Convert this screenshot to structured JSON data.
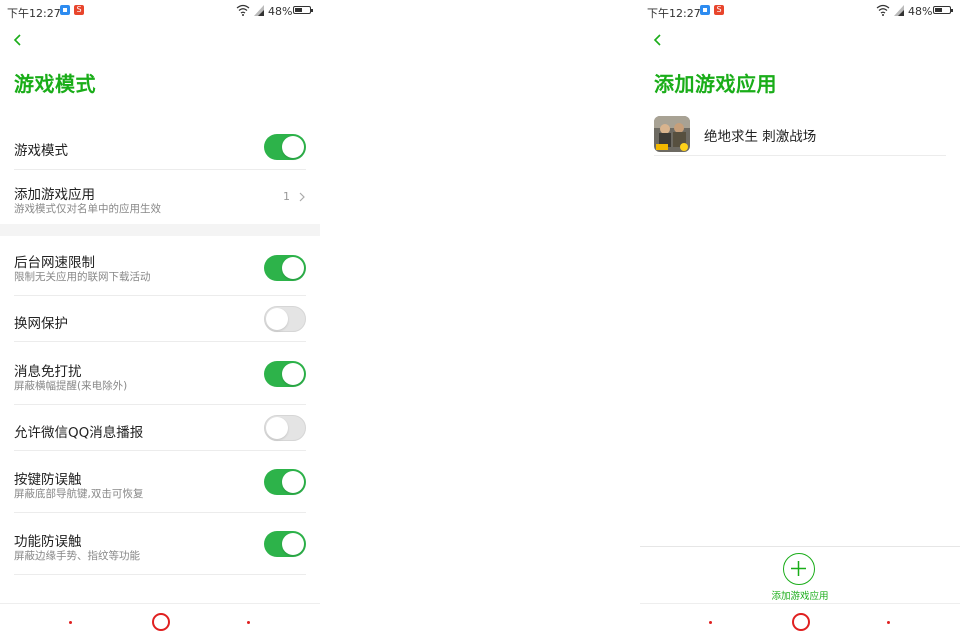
{
  "colors": {
    "accent": "#1aad19",
    "toggle_on": "#2db34a",
    "toggle_off": "#e4e4e4",
    "nav_red": "#e02020"
  },
  "status_bar": {
    "time": "下午12:27",
    "battery": "48%",
    "battery_level": 0.48
  },
  "left_screen": {
    "title": "游戏模式",
    "settings": [
      {
        "title": "游戏模式",
        "subtitle": "",
        "control": "toggle",
        "on": true
      },
      {
        "title": "添加游戏应用",
        "subtitle": "游戏模式仅对名单中的应用生效",
        "control": "count",
        "count": "1"
      },
      {
        "title": "后台网速限制",
        "subtitle": "限制无关应用的联网下载活动",
        "control": "toggle",
        "on": true
      },
      {
        "title": "换网保护",
        "subtitle": "",
        "control": "toggle",
        "on": false
      },
      {
        "title": "消息免打扰",
        "subtitle": "屏蔽横幅提醒(来电除外)",
        "control": "toggle",
        "on": true
      },
      {
        "title": "允许微信QQ消息播报",
        "subtitle": "",
        "control": "toggle",
        "on": false
      },
      {
        "title": "按键防误触",
        "subtitle": "屏蔽底部导航键,双击可恢复",
        "control": "toggle",
        "on": true
      },
      {
        "title": "功能防误触",
        "subtitle": "屏蔽边缘手势、指纹等功能",
        "control": "toggle",
        "on": true
      }
    ]
  },
  "right_screen": {
    "title": "添加游戏应用",
    "apps": [
      {
        "name": "绝地求生 刺激战场"
      }
    ],
    "add_label": "添加游戏应用"
  },
  "icons": {
    "back": "chevron-left-icon",
    "chevron": "chevron-right-icon",
    "add": "plus-icon",
    "wifi": "wifi-icon",
    "signal": "signal-icon",
    "battery": "battery-icon"
  }
}
